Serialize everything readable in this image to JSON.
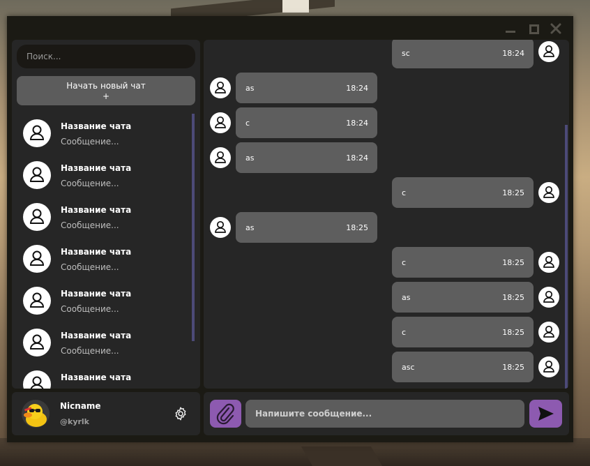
{
  "window": {
    "controls": {
      "minimize": "minimize",
      "maximize": "maximize",
      "close": "✕"
    }
  },
  "sidebar": {
    "search_placeholder": "Поиск...",
    "new_chat_label": "Начать новый чат",
    "new_chat_plus": "+",
    "chats": [
      {
        "name": "Название чата",
        "preview": "Сообщение..."
      },
      {
        "name": "Название чата",
        "preview": "Сообщение..."
      },
      {
        "name": "Название чата",
        "preview": "Сообщение..."
      },
      {
        "name": "Название чата",
        "preview": "Сообщение..."
      },
      {
        "name": "Название чата",
        "preview": "Сообщение..."
      },
      {
        "name": "Название чата",
        "preview": "Сообщение..."
      },
      {
        "name": "Название чата",
        "preview": ""
      }
    ]
  },
  "profile": {
    "name": "Nicname",
    "username": "@kyrlk"
  },
  "messages": [
    {
      "side": "right",
      "text": "sc",
      "time": "18:24"
    },
    {
      "side": "left",
      "text": "as",
      "time": "18:24"
    },
    {
      "side": "left",
      "text": "c",
      "time": "18:24"
    },
    {
      "side": "left",
      "text": "as",
      "time": "18:24"
    },
    {
      "side": "right",
      "text": "c",
      "time": "18:25"
    },
    {
      "side": "left",
      "text": "as",
      "time": "18:25"
    },
    {
      "side": "right",
      "text": "c",
      "time": "18:25"
    },
    {
      "side": "right",
      "text": "as",
      "time": "18:25"
    },
    {
      "side": "right",
      "text": "c",
      "time": "18:25"
    },
    {
      "side": "right",
      "text": "asc",
      "time": "18:25"
    }
  ],
  "composer": {
    "placeholder": "Напишите сообщение..."
  },
  "colors": {
    "accent": "#8d5ab0",
    "scrollbar": "#4c4a78",
    "bubble": "#5e5e5e",
    "panel": "#262626"
  }
}
